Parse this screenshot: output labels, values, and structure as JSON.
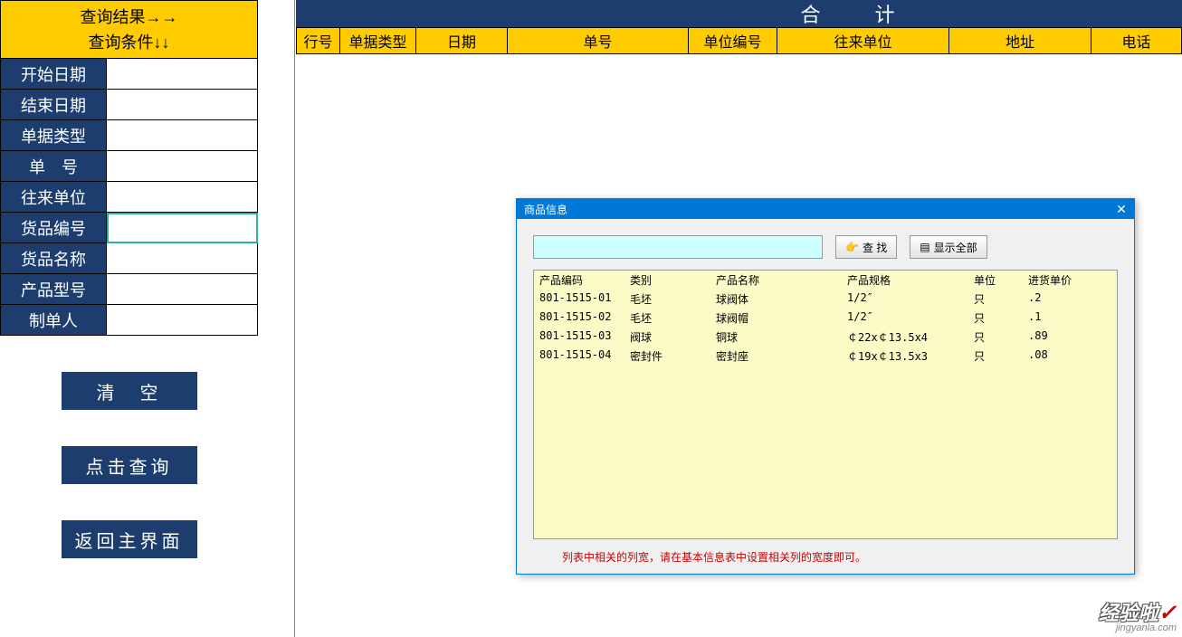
{
  "left_header": {
    "line1": "查询结果→→",
    "line2": "查询条件↓↓"
  },
  "form_labels": {
    "start_date": "开始日期",
    "end_date": "结束日期",
    "doc_type": "单据类型",
    "doc_no": "单　号",
    "partner": "往来单位",
    "product_code": "货品编号",
    "product_name": "货品名称",
    "product_model": "产品型号",
    "creator": "制单人"
  },
  "buttons": {
    "clear": "清　空",
    "query": "点击查询",
    "back": "返回主界面"
  },
  "total_label": "合计",
  "table_cols": {
    "c0": "行号",
    "c1": "单据类型",
    "c2": "日期",
    "c3": "单号",
    "c4": "单位编号",
    "c5": "往来单位",
    "c6": "地址",
    "c7": "电话"
  },
  "dialog": {
    "title": "商品信息",
    "search_btn": "查 找",
    "show_all_btn": "显示全部",
    "cols": {
      "code": "产品编码",
      "cat": "类别",
      "name": "产品名称",
      "spec": "产品规格",
      "unit": "单位",
      "price": "进货单价"
    },
    "rows": [
      {
        "code": "801-1515-01",
        "cat": "毛坯",
        "name": "球阀体",
        "spec": "1/2″",
        "unit": "只",
        "price": ".2"
      },
      {
        "code": "801-1515-02",
        "cat": "毛坯",
        "name": "球阀帽",
        "spec": "1/2″",
        "unit": "只",
        "price": ".1"
      },
      {
        "code": "801-1515-03",
        "cat": "阀球",
        "name": "铜球",
        "spec": "￠22x￠13.5x4",
        "unit": "只",
        "price": ".89"
      },
      {
        "code": "801-1515-04",
        "cat": "密封件",
        "name": "密封座",
        "spec": "￠19x￠13.5x3",
        "unit": "只",
        "price": ".08"
      }
    ],
    "footer": "列表中相关的列宽，请在基本信息表中设置相关列的宽度即可。"
  },
  "watermark": {
    "line1": "经验啦",
    "line2": "jingyanla.com"
  }
}
